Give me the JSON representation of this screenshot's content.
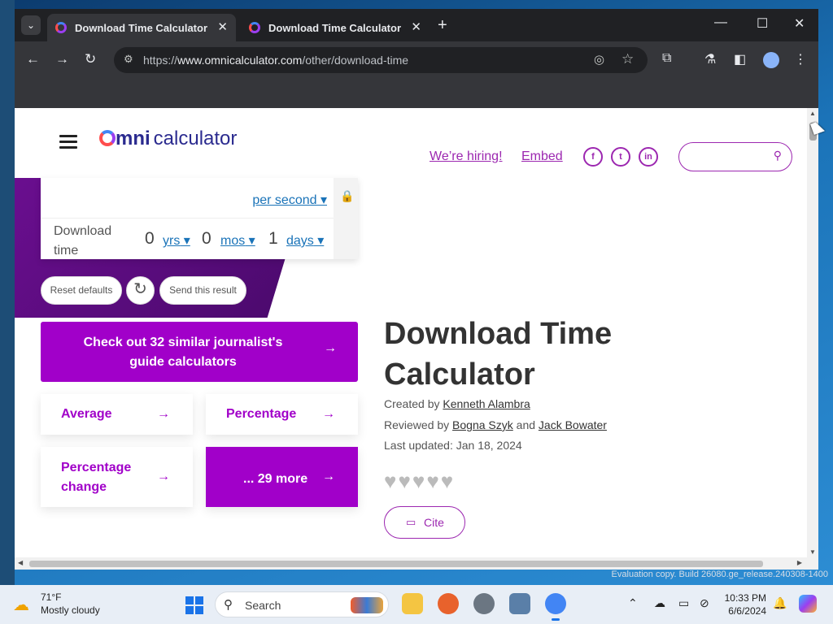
{
  "browser": {
    "tabs": [
      {
        "title": "Download Time Calculator",
        "active": true
      },
      {
        "title": "Download Time Calculator",
        "active": false
      }
    ],
    "url": {
      "prefix": "https://",
      "domain": "www.omnicalculator.com",
      "path": "/other/download-time"
    },
    "icons": [
      "tab-list-icon",
      "back-icon",
      "forward-icon",
      "reload-icon",
      "site-info-icon",
      "eye-off-icon",
      "star-icon",
      "extensions-icon",
      "labs-icon",
      "side-panel-icon",
      "profile-icon",
      "menu-icon"
    ]
  },
  "site": {
    "logo_omni": "mni",
    "logo_calculator": "calculator",
    "links": {
      "hiring": "We’re hiring!",
      "embed": "Embed"
    },
    "social": {
      "facebook": "f",
      "twitter": "t",
      "linkedin": "in"
    },
    "accent_color": "#a100c9"
  },
  "calculator": {
    "rate_unit": "per second",
    "download_time_label": "Download time",
    "years_value": "0",
    "years_unit": "yrs",
    "months_value": "0",
    "months_unit": "mos",
    "days_value": "1",
    "days_unit": "days",
    "reset_button": "Reset defaults",
    "send_button": "Send this result"
  },
  "related": {
    "cta": "Check out 32 similar journalist's guide calculators",
    "cards": [
      "Average",
      "Percentage",
      "Percentage change"
    ],
    "more": "... 29 more"
  },
  "article": {
    "title": "Download Time Calculator",
    "created_label": "Created by",
    "created_by": "Kenneth Alambra",
    "reviewed_label": "Reviewed by",
    "reviewer_1": "Bogna Szyk",
    "and_label": "and",
    "reviewer_2": "Jack Bowater",
    "last_updated": "Last updated: Jan 18, 2024",
    "rating_hearts": "♥♥♥♥♥",
    "cite_button": "Cite"
  },
  "desktop": {
    "evaluation_text": "Evaluation copy. Build 26080.ge_release.240308-1400"
  },
  "taskbar": {
    "weather_temp": "71°F",
    "weather_desc": "Mostly cloudy",
    "search_placeholder": "Search",
    "time": "10:33 PM",
    "date": "6/6/2024"
  }
}
